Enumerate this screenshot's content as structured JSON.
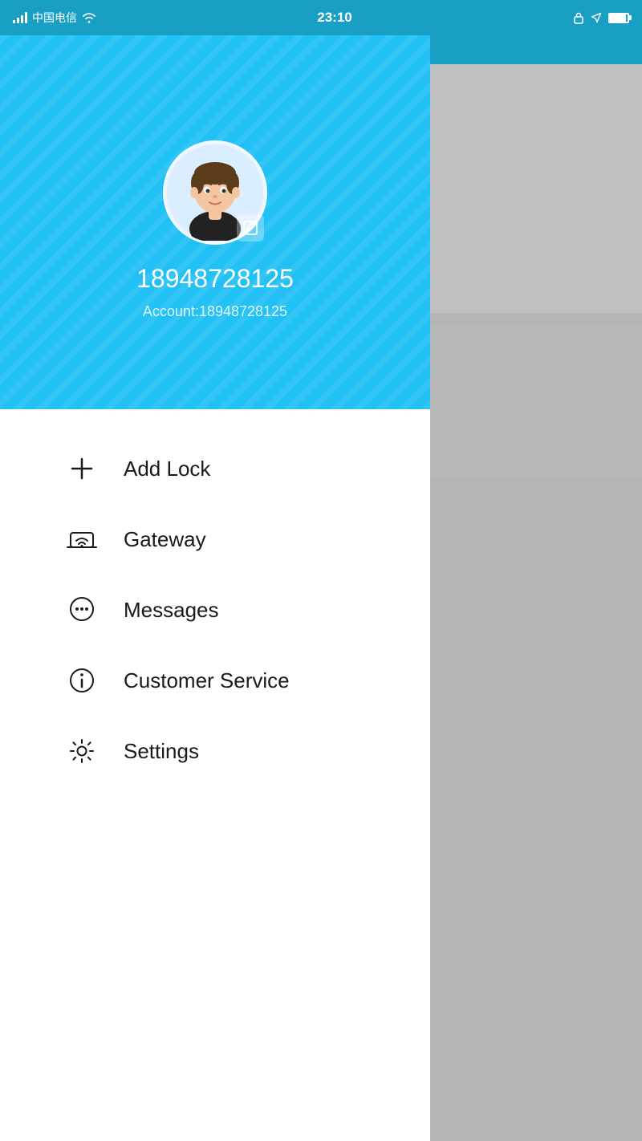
{
  "statusBar": {
    "carrier": "中国电信",
    "time": "23:10",
    "lockIconTitle": "lock-icon"
  },
  "profile": {
    "phone": "18948728125",
    "account_label": "Account:",
    "account": "18948728125"
  },
  "menu": {
    "items": [
      {
        "id": "add-lock",
        "label": "Add Lock",
        "icon": "plus"
      },
      {
        "id": "gateway",
        "label": "Gateway",
        "icon": "gateway"
      },
      {
        "id": "messages",
        "label": "Messages",
        "icon": "chat"
      },
      {
        "id": "customer-service",
        "label": "Customer Service",
        "icon": "info"
      },
      {
        "id": "settings",
        "label": "Settings",
        "icon": "gear"
      }
    ]
  }
}
